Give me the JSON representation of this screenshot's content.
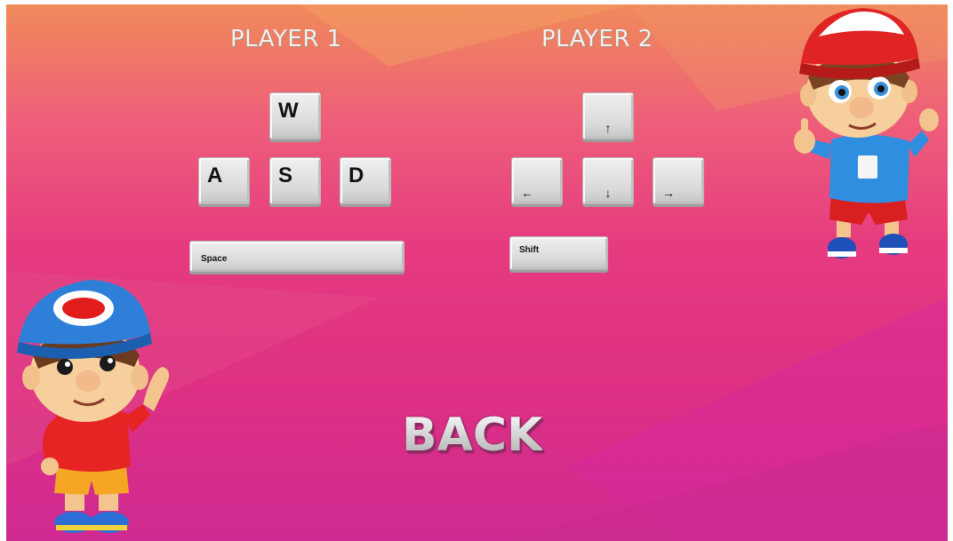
{
  "players": {
    "p1": {
      "title": "PLAYER 1",
      "keys": {
        "up": "W",
        "left": "A",
        "down": "S",
        "right": "D",
        "action": "Space"
      }
    },
    "p2": {
      "title": "PLAYER 2",
      "keys": {
        "up": "↑",
        "left": "←",
        "down": "↓",
        "right": "→",
        "action": "Shift"
      }
    }
  },
  "back_label": "BACK",
  "colors": {
    "bg_top": "#f08a5a",
    "bg_bottom": "#cf2a92",
    "key_face": "#e4e4e4",
    "title": "#f3f1ee"
  },
  "characters": [
    "boy-blue-cap-waving",
    "boy-red-cap-thumbs-up"
  ]
}
